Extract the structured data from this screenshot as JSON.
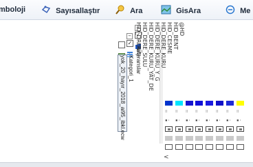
{
  "toolbar": {
    "items": [
      {
        "label": "mboloji",
        "icon": "none"
      },
      {
        "label": "Sayısallaştır",
        "icon": "digitize-icon"
      },
      {
        "label": "Ara",
        "icon": "search-icon"
      },
      {
        "label": "GisAra",
        "icon": "gis-search-icon"
      },
      {
        "label": "Me",
        "icon": "measure-icon"
      }
    ]
  },
  "tree": {
    "root_label": "Referanslar",
    "category_label": "Kategori_1",
    "file_label": "yok_20_hayır_2018_ai95_ibkl.ecw"
  },
  "fields": [
    "@HD",
    "HID_BENT",
    "HID_CESME",
    "HID_DERE_KURU",
    "HID_DERE_KURU_Y_G",
    "HID_DERE_KURU_YAT_DE",
    "HID_DERE_SULU",
    "HID_DRENAJ"
  ],
  "colors": {
    "swatches": [
      "#0033cc",
      "#00e5ff",
      "#1414d0",
      "#0f0fd8",
      "#1a1ae0",
      "#1010c8",
      "#1e2bd6",
      "#ffff00"
    ]
  }
}
